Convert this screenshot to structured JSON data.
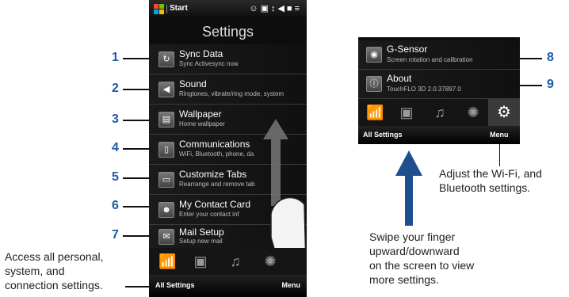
{
  "status_bar": {
    "start": "Start"
  },
  "left_screen": {
    "title": "Settings",
    "items": [
      {
        "title": "Sync Data",
        "subtitle": "Sync Activesync now",
        "icon": "sync-icon"
      },
      {
        "title": "Sound",
        "subtitle": "Ringtones, vibrate/ring mode, system",
        "icon": "speaker-icon"
      },
      {
        "title": "Wallpaper",
        "subtitle": "Home wallpaper",
        "icon": "wallpaper-icon"
      },
      {
        "title": "Communications",
        "subtitle": "WiFi, Bluetooth, phone, da",
        "icon": "communications-icon"
      },
      {
        "title": "Customize Tabs",
        "subtitle": "Rearrange and remove tab",
        "icon": "tabs-icon"
      },
      {
        "title": "My Contact Card",
        "subtitle": "Enter your contact inf",
        "icon": "contact-card-icon"
      },
      {
        "title": "Mail Setup",
        "subtitle": "Setup new mail",
        "icon": "mail-icon"
      }
    ],
    "tabs": [
      "chart-icon",
      "camera-icon",
      "music-icon",
      "settings-sun-icon"
    ],
    "bottom_left": "All Settings",
    "bottom_right": "Menu"
  },
  "right_screen": {
    "items": [
      {
        "title": "G-Sensor",
        "subtitle": "Screen rotation and calibration",
        "icon": "gsensor-icon"
      },
      {
        "title": "About",
        "subtitle": "TouchFLO 3D 2.0.37897.0",
        "icon": "about-icon"
      }
    ],
    "tabs": [
      "chart-icon",
      "camera-icon",
      "music-icon",
      "settings-sun-icon",
      "gear-icon"
    ],
    "bottom_left": "All Settings",
    "bottom_right": "Menu"
  },
  "callout_numbers": [
    "1",
    "2",
    "3",
    "4",
    "5",
    "6",
    "7",
    "8",
    "9"
  ],
  "captions": {
    "left": [
      "Access all personal,",
      "system, and",
      "connection settings."
    ],
    "middle": [
      "Swipe your finger",
      "upward/downward",
      "on the screen to view",
      "more settings."
    ],
    "right": [
      "Adjust the Wi-Fi, and",
      "Bluetooth settings."
    ]
  },
  "colors": {
    "callout_number": "#1f5aa6",
    "arrow": "#1f4f8f",
    "phone_bg": "#0d0d0d"
  }
}
